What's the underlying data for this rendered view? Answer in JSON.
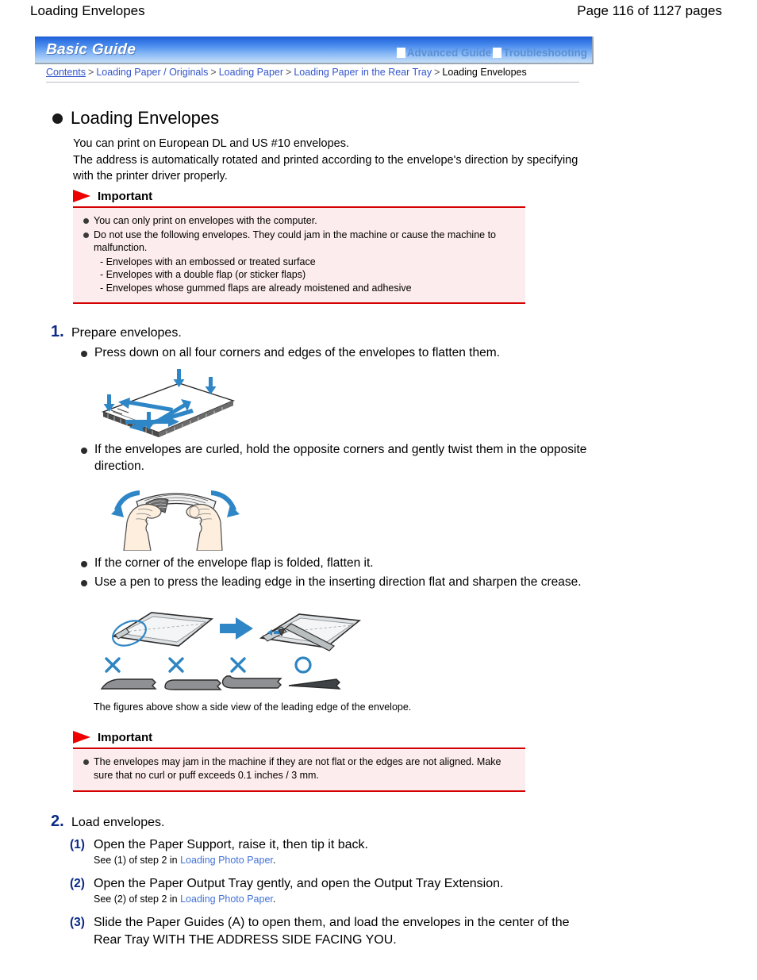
{
  "header": {
    "doc_title": "Loading Envelopes",
    "page_count": "Page 116 of 1127 pages"
  },
  "banner": {
    "brand": "Basic Guide",
    "advanced_guide": "Advanced Guide",
    "troubleshooting": "Troubleshooting",
    "gradient_start": "#1f5fd8",
    "gradient_end": "#c5def6",
    "link_color": "#5b8fd4"
  },
  "breadcrumb": {
    "items": [
      {
        "label": "Contents",
        "link": true
      },
      {
        "label": "Loading Paper / Originals",
        "link": true
      },
      {
        "label": "Loading Paper",
        "link": true
      },
      {
        "label": "Loading Paper in the Rear Tray",
        "link": true
      },
      {
        "label": "Loading Envelopes",
        "link": false
      }
    ],
    "separator": ">",
    "link_color": "#3355cc"
  },
  "section": {
    "title": "Loading Envelopes",
    "intro_line_1": "You can print on European DL and US #10 envelopes.",
    "intro_line_2": "The address is automatically rotated and printed according to the envelope's direction by specifying",
    "intro_line_3": "with the printer driver properly."
  },
  "important_1": {
    "title": "Important",
    "flag_color": "#ee0000",
    "border_color": "#d40000",
    "background": "#fdeced",
    "bullets": [
      "You can only print on envelopes with the computer.",
      "Do not use the following envelopes. They could jam in the machine or cause the machine to malfunction."
    ],
    "sub_items": [
      "- Envelopes with an embossed or treated surface",
      "- Envelopes with a double flap (or sticker flaps)",
      "- Envelopes whose gummed flaps are already moistened and adhesive"
    ]
  },
  "step_1": {
    "number": "1.",
    "text": "Prepare envelopes.",
    "bullet_1": "Press down on all four corners and edges of the envelopes to flatten them.",
    "bullet_2_line_1": "If the envelopes are curled, hold the opposite corners and gently twist them in the",
    "bullet_2_line_2": "opposite direction.",
    "bullet_3": "If the corner of the envelope flap is folded, flatten it.",
    "bullet_4_line_1": "Use a pen to press the leading edge in the inserting direction flat and sharpen the",
    "bullet_4_line_2": "crease.",
    "caption": "The figures above show a side view of the leading edge of the envelope.",
    "marks": [
      "X",
      "X",
      "X",
      "O"
    ],
    "mark_color": "#2e86c1",
    "arrow_color": "#2f86c6"
  },
  "important_2": {
    "title": "Important",
    "bullet_line_1": "The envelopes may jam in the machine if they are not flat or the edges are not aligned. Make",
    "bullet_line_2": "sure that no curl or puff exceeds 0.1 inches / 3 mm."
  },
  "step_2": {
    "number": "2.",
    "text": "Load envelopes.",
    "substeps": [
      {
        "num": "(1)",
        "text": "Open the Paper Support, raise it, then tip it back.",
        "see_prefix": "See (1) of step 2 in",
        "see_link": "Loading Photo Paper",
        "see_suffix": "."
      },
      {
        "num": "(2)",
        "text": "Open the Paper Output Tray gently, and open the Output Tray Extension.",
        "see_prefix": "See (2) of step 2 in",
        "see_link": "Loading Photo Paper",
        "see_suffix": "."
      },
      {
        "num": "(3)",
        "text_line_1": "Slide the Paper Guides (A) to open them, and load the envelopes in the center of",
        "text_line_2": "the Rear Tray WITH THE ADDRESS SIDE FACING YOU."
      }
    ],
    "num_color": "#0a2a86",
    "link_color": "#4472d8"
  }
}
